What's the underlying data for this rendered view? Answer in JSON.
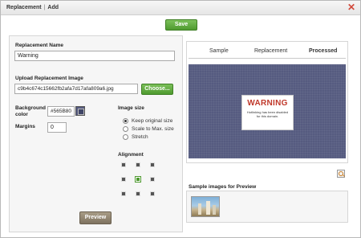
{
  "window": {
    "title": "Replacement",
    "title_separator": "|",
    "title_sub": "Add",
    "close_icon": "close-icon"
  },
  "toolbar": {
    "save_label": "Save"
  },
  "form": {
    "name_label": "Replacement Name",
    "name_value": "Warning",
    "upload_label": "Upload Replacement Image",
    "upload_value": "c9b4c674c15662fb2afa7d17afa809a6.jpg",
    "choose_label": "Choose...",
    "bg_color_label": "Background color",
    "bg_color_value": "#565B80",
    "margins_label": "Margins",
    "margins_value": "0",
    "image_size_label": "Image size",
    "image_size_options": [
      {
        "label": "Keep original size",
        "selected": true
      },
      {
        "label": "Scale to Max. size",
        "selected": false
      },
      {
        "label": "Stretch",
        "selected": false
      }
    ],
    "alignment_label": "Alignment",
    "alignment_selected": "center",
    "preview_label": "Preview"
  },
  "preview": {
    "tabs": [
      "Sample",
      "Replacement",
      "Processed"
    ],
    "active_tab": "Processed",
    "background_color": "#565B80",
    "warning_title": "WARNING",
    "warning_message": "Hotlinking has been disabled for this domain.",
    "zoom_icon": "zoom-icon"
  },
  "samples": {
    "label": "Sample images for Preview",
    "thumbnail_icon": "city-skyline-thumbnail"
  },
  "colors": {
    "save_green": "#5aa83a",
    "preview_button": "#9a8e78",
    "warning_red": "#c0392b",
    "close_red": "#d24a3c"
  }
}
